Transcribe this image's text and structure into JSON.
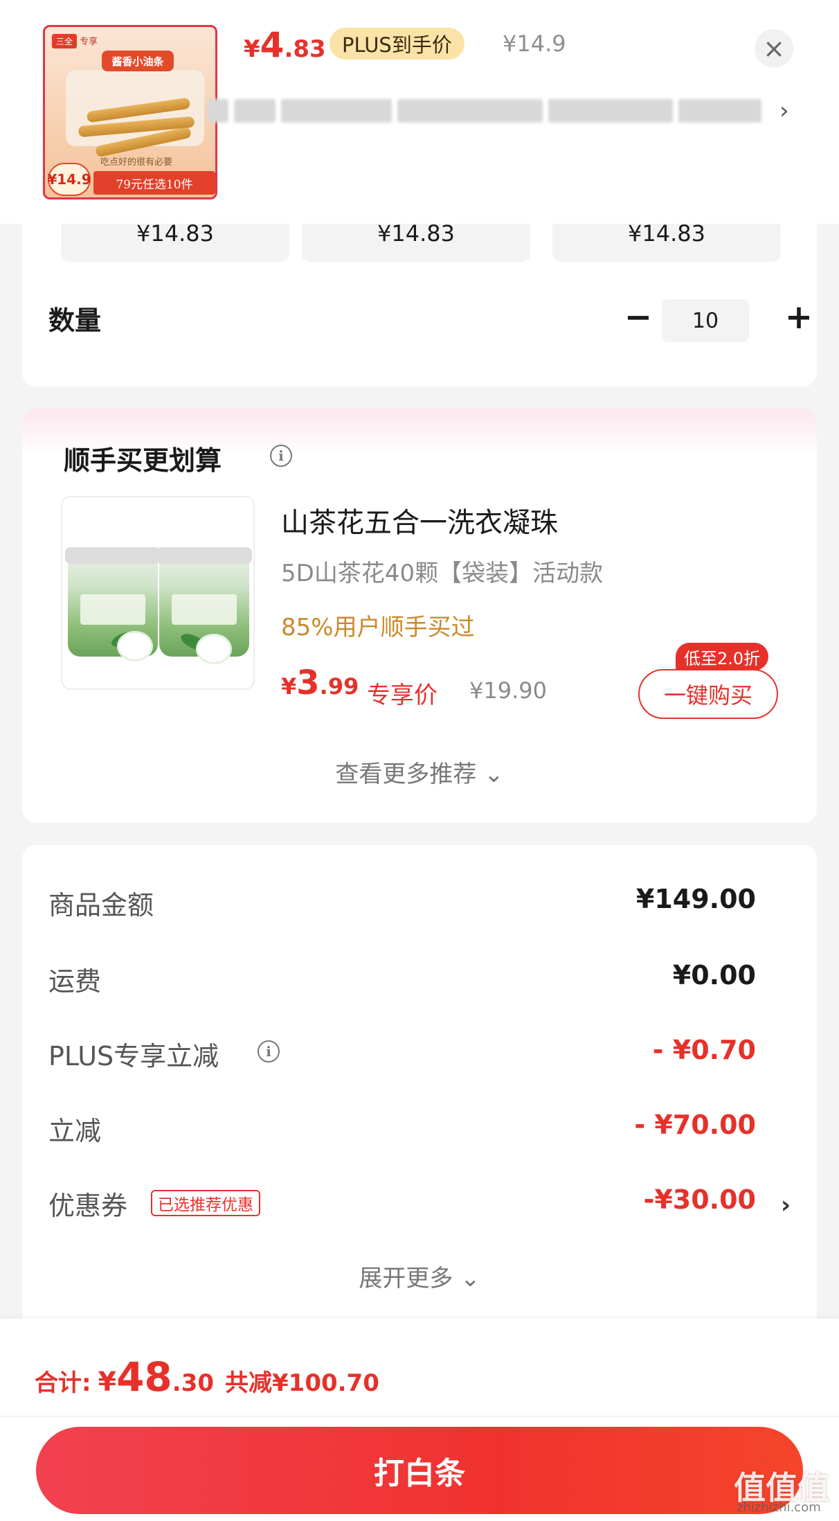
{
  "header": {
    "thumb": {
      "brand_tag": "三全",
      "brand_sub": "专享",
      "pack_label": "酱香小油条",
      "sub_text": "吃点好的很有必要",
      "price_badge": "¥14.9",
      "tagline": "79元任选10件"
    },
    "plus_price": {
      "yen": "¥",
      "int": "4",
      "dec": ".83"
    },
    "plus_tag": "PLUS到手价",
    "original_price": "¥14.9",
    "close_icon": "close-icon",
    "chevron_icon": "chevron-right-icon",
    "chevron_glyph": "›"
  },
  "spec": {
    "options": [
      {
        "price": "¥14.83"
      },
      {
        "price": "¥14.83"
      },
      {
        "price": "¥14.83"
      }
    ],
    "quantity_label": "数量",
    "minus_glyph": "−",
    "plus_glyph": "+",
    "quantity_value": "10"
  },
  "recommend": {
    "title": "顺手买更划算",
    "info_glyph": "i",
    "product": {
      "name": "山茶花五合一洗衣凝珠",
      "spec": "5D山茶花40颗【袋装】活动款",
      "social_proof": "85%用户顺手买过",
      "price": {
        "yen": "¥",
        "int": "3",
        "dec": ".99"
      },
      "price_label": "专享价",
      "original_price": "¥19.90",
      "buy_button": "一键购买",
      "discount_badge": "低至2.0折"
    },
    "more_link": "查看更多推荐 ⌄"
  },
  "summary": {
    "rows": [
      {
        "label": "商品金额",
        "value": "¥149.00"
      },
      {
        "label": "运费",
        "value": "¥0.00"
      },
      {
        "label": "PLUS专享立减",
        "value": "- ¥0.70"
      },
      {
        "label": "立减",
        "value": "- ¥70.00"
      },
      {
        "label": "优惠券",
        "value": "-¥30.00"
      }
    ],
    "coupon_tag": "已选推荐优惠",
    "coupon_chevron": "›",
    "expand_link": "展开更多 ⌄",
    "accent_color": "#e6312b"
  },
  "bottom": {
    "total_label": "合计:",
    "total": {
      "yen": "¥",
      "int": "48",
      "dec": ".30"
    },
    "saved": "共减¥100.70",
    "pay_button": "打白条"
  },
  "watermark": {
    "logo": "值值值",
    "site": "zhizhizhi.com"
  }
}
